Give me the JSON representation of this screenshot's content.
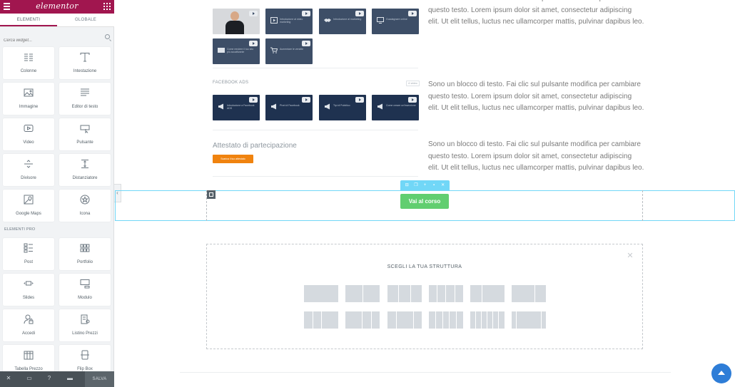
{
  "sidebar": {
    "logo": "elementor",
    "tabs": [
      "ELEMENTI",
      "GLOBALE"
    ],
    "search_placeholder": "Cerca widget...",
    "widgets": [
      {
        "label": "Colonne",
        "icon": "columns-icon"
      },
      {
        "label": "Intestazione",
        "icon": "heading-icon"
      },
      {
        "label": "Immagine",
        "icon": "image-icon"
      },
      {
        "label": "Editor di testo",
        "icon": "text-editor-icon"
      },
      {
        "label": "Video",
        "icon": "video-icon"
      },
      {
        "label": "Pulsante",
        "icon": "button-icon"
      },
      {
        "label": "Divisore",
        "icon": "divider-icon"
      },
      {
        "label": "Distanziatore",
        "icon": "spacer-icon"
      },
      {
        "label": "Google Maps",
        "icon": "map-icon"
      },
      {
        "label": "Icona",
        "icon": "star-icon"
      }
    ],
    "pro_title": "ELEMENTI PRO",
    "pro_widgets": [
      {
        "label": "Post",
        "icon": "posts-icon"
      },
      {
        "label": "Portfolio",
        "icon": "portfolio-icon"
      },
      {
        "label": "Slides",
        "icon": "slides-icon"
      },
      {
        "label": "Modulo",
        "icon": "form-icon"
      },
      {
        "label": "Accedi",
        "icon": "login-icon"
      },
      {
        "label": "Listino Prezzi",
        "icon": "price-list-icon"
      },
      {
        "label": "Tabella Prezzo",
        "icon": "price-table-icon"
      },
      {
        "label": "Flip Box",
        "icon": "flip-box-icon"
      }
    ],
    "footer_save": "SALVA"
  },
  "content": {
    "sections": [
      {
        "label": "",
        "thumbnails": [
          {
            "text": ""
          },
          {
            "text": "Introduzione al video marketing"
          },
          {
            "text": "Introduzione al marketing"
          },
          {
            "text": "Guadagnare online"
          },
          {
            "text": "Come rendere il tuo sito più accattivante"
          },
          {
            "text": "Aumentare le vendite"
          }
        ]
      },
      {
        "label": "FACEBOOK ADS",
        "badge": "4 video",
        "thumbnails": [
          {
            "text": "Introduzione a Facebook ADS"
          },
          {
            "text": "Pixel di Facebook"
          },
          {
            "text": "Tipi di Pubblico"
          },
          {
            "text": "Come creare un'inserzione"
          }
        ]
      }
    ],
    "certificate_title": "Attestato di partecipazione",
    "certificate_button": "Scarica il tuo attestato",
    "text_block_lines": [
      "Sono un blocco di testo. Fai clic sul pulsante modifica per cambiare",
      "questo testo. Lorem ipsum dolor sit amet, consectetur adipiscing",
      "elit. Ut elit tellus, luctus nec ullamcorper mattis, pulvinar dapibus leo."
    ],
    "course_button": "Vai al corso",
    "structure_title": "SCEGLI LA TUA STRUTTURA"
  }
}
